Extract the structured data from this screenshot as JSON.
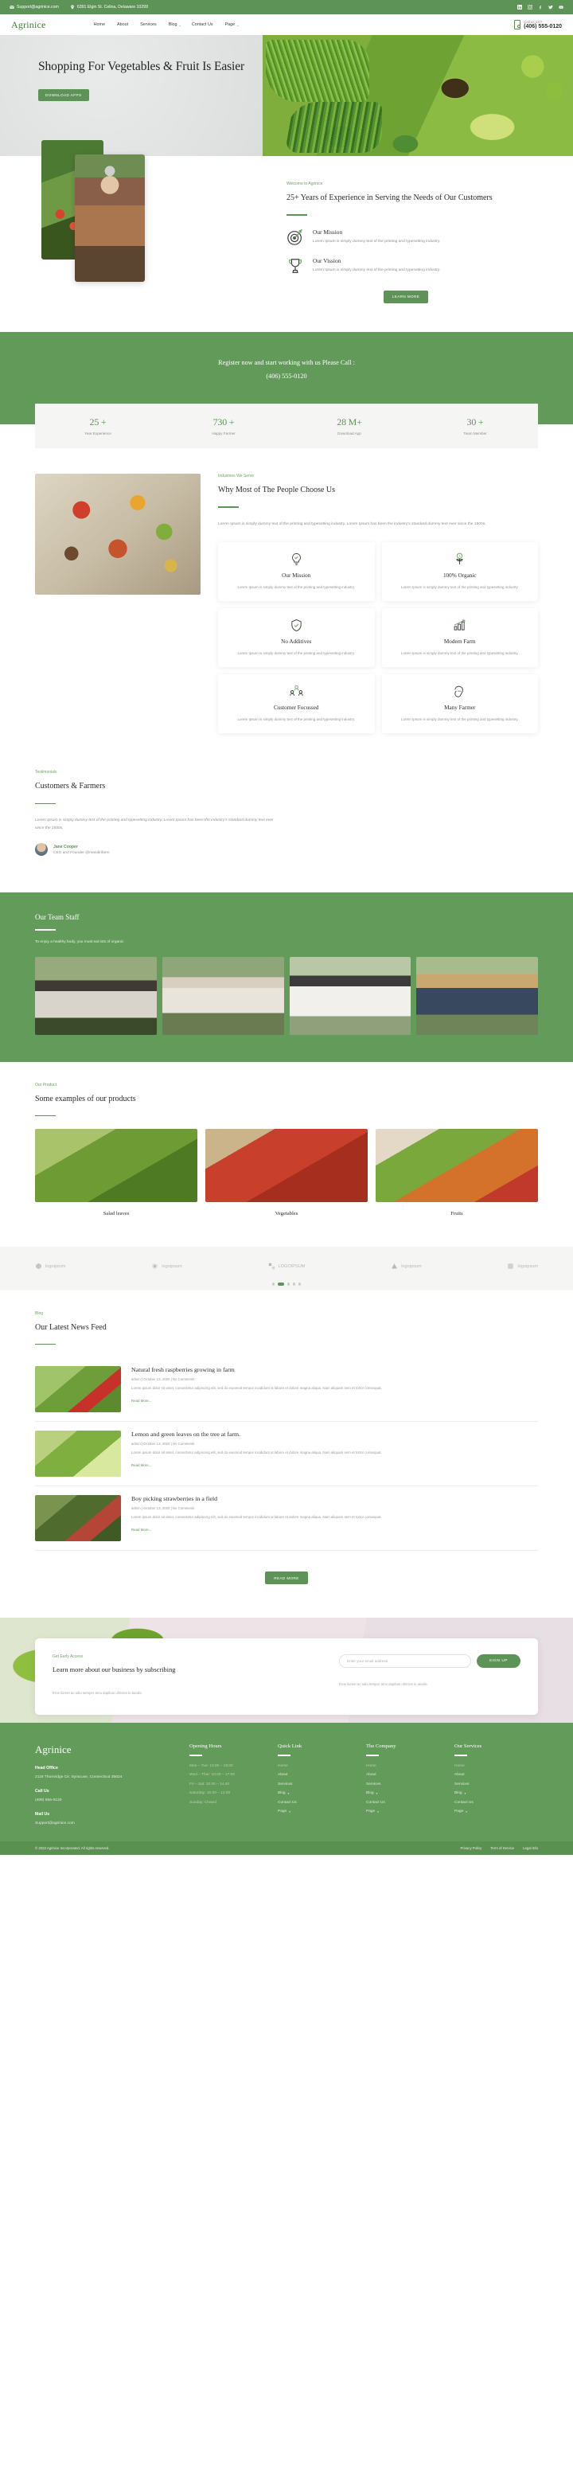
{
  "topbar": {
    "email": "Support@agrinice.com",
    "address": "6391 Elgin St. Celina, Delaware 10299",
    "socials": [
      "linkedin-icon",
      "instagram-icon",
      "facebook-icon",
      "twitter-icon",
      "youtube-icon"
    ]
  },
  "nav": {
    "brand": "Agrinice",
    "links": [
      {
        "label": "Home",
        "caret": ""
      },
      {
        "label": "About",
        "caret": ""
      },
      {
        "label": "Services",
        "caret": ""
      },
      {
        "label": "Blog",
        "caret": "⌄"
      },
      {
        "label": "Contact Us",
        "caret": ""
      },
      {
        "label": "Page",
        "caret": "⌄"
      }
    ],
    "call_label": "Call us 24/7",
    "call_number": "(406) 555-0120"
  },
  "hero": {
    "title": "Shopping For Vegetables & Fruit Is Easier",
    "button": "DOWNLOAD APPS"
  },
  "about": {
    "eyebrow": "Welcome to Agrinice",
    "title": "25+ Years of Experience in Serving the Needs of Our Customers",
    "features": [
      {
        "icon": "target-icon",
        "title": "Our Mission",
        "text": "Lorem Ipsum is simply dummy text of the printing and typesetting industry."
      },
      {
        "icon": "trophy-icon",
        "title": "Our Vission",
        "text": "Lorem Ipsum is simply dummy text of the printing and typesetting industry."
      }
    ],
    "button": "LEARN MORE"
  },
  "cta": {
    "line1": "Register now and start working with us Please Call :",
    "line2": "(406) 555-0120"
  },
  "stats": [
    {
      "number": "25 +",
      "label": "Year Experience"
    },
    {
      "number": "730 +",
      "label": "Happy Farmer"
    },
    {
      "number": "28 M+",
      "label": "Download App"
    },
    {
      "number": "30 +",
      "label": "Team Member"
    }
  ],
  "why": {
    "eyebrow": "Industries We Serve",
    "title": "Why Most of The People Choose Us",
    "paragraph": "Lorem Ipsum is simply dummy text of the printing and typesetting industry. Lorem Ipsum has been the industry's standard dummy text ever since the 1500s,",
    "cards": [
      {
        "icon": "lightbulb-icon",
        "title": "Our Mission",
        "text": "Lorem Ipsum is simply dummy text of the printing and typesetting industry."
      },
      {
        "icon": "organic-plant-icon",
        "title": "100% Organic",
        "text": "Lorem Ipsum is simply dummy text of the printing and typesetting industry."
      },
      {
        "icon": "shield-check-icon",
        "title": "No Additives",
        "text": "Lorem Ipsum is simply dummy text of the printing and typesetting industry."
      },
      {
        "icon": "growth-chart-icon",
        "title": "Modern Farm",
        "text": "Lorem Ipsum is simply dummy text of the printing and typesetting industry."
      },
      {
        "icon": "people-group-icon",
        "title": "Customer Focussed",
        "text": "Lorem Ipsum is simply dummy text of the printing and typesetting industry."
      },
      {
        "icon": "strong-arm-icon",
        "title": "Many Farmer",
        "text": "Lorem Ipsum is simply dummy text of the printing and typesetting industry."
      }
    ]
  },
  "testimonials": {
    "eyebrow": "Testimonials",
    "title": "Customers & Farmers",
    "quote": "Lorem Ipsum is simply dummy text of the printing and typesetting industry. Lorem Ipsum has been the industry's standard dummy text ever since the 1500s,",
    "author_name": "Jane Cooper",
    "author_role": "CEO and Founder @mandirifarm"
  },
  "team": {
    "title": "Our Team Staff",
    "subtitle": "To enjoy a healthy body, you must eat lots of organic",
    "members": [
      "team-member-1",
      "team-member-2",
      "team-member-3",
      "team-member-4"
    ]
  },
  "products": {
    "eyebrow": "Our Product",
    "title": "Some examples of our products",
    "items": [
      {
        "name": "Salad leaves"
      },
      {
        "name": "Vegetables"
      },
      {
        "name": "Fruits"
      }
    ]
  },
  "logos": [
    {
      "label": "logoipsum"
    },
    {
      "label": "logoipsum"
    },
    {
      "label": "LOGOIPSUM"
    },
    {
      "label": "logoipsum"
    },
    {
      "label": "logoipsum"
    }
  ],
  "carousel_dots": 5,
  "carousel_active": 1,
  "blog": {
    "eyebrow": "Blog",
    "title": "Our Latest News Feed",
    "posts": [
      {
        "title": "Natural fresh raspberries growing in farm",
        "meta": "admin | October 13, 2020 | No Comments",
        "text": "Lorem ipsum dolor sit amet, consectetur adipiscing elit, sed do eiusmod tempor incididunt ut labore et dolore magna aliqua. Nam aliquam sem et tortor consequat.",
        "link": "Read More..."
      },
      {
        "title": "Lemon and green leaves on the tree at farm.",
        "meta": "admin | October 13, 2020 | No Comments",
        "text": "Lorem ipsum dolor sit amet, consectetur adipiscing elit, sed do eiusmod tempor incididunt ut labore et dolore magna aliqua. Nam aliquam sem et tortor consequat.",
        "link": "Read More..."
      },
      {
        "title": "Boy picking strawberries in a field",
        "meta": "admin | October 13, 2020 | No Comments",
        "text": "Lorem ipsum dolor sit amet, consectetur adipiscing elit, sed do eiusmod tempor incididunt ut labore et dolore magna aliqua. Nam aliquam sem et tortor consequat.",
        "link": "Read More..."
      }
    ],
    "more_button": "READ MORE"
  },
  "newsletter": {
    "eyebrow": "Get Early Access",
    "title": "Learn more about our business by subscribing",
    "note_left": "Eros lioreet ac odio semper arcu dapibus ultricies in iaculis.",
    "note_right": "Eros lioreet ac odio tempor arcu dapibus ultricies in iaculis.",
    "placeholder": "Enter your email address",
    "button": "SIGN UP"
  },
  "footer": {
    "brand": "Agrinice",
    "head_office_label": "Head Office",
    "head_office_value": "2118 Thornridge Cir. Syracuse, Connecticut 35624",
    "call_label": "Call Us",
    "call_value": "(406) 555-0120",
    "mail_label": "Mail Us",
    "mail_value": "Support@agrinice.com",
    "columns": [
      {
        "title": "Opening Hours",
        "items": [
          {
            "label": "Mon – Tue: 10.00 – 18.00",
            "caret": ""
          },
          {
            "label": "Wed – Thur: 10.00 – 17.00",
            "caret": ""
          },
          {
            "label": "Fri – Sat: 10.00 – 14.00",
            "caret": ""
          },
          {
            "label": "Saturday: 10.00 – 12.00",
            "caret": ""
          },
          {
            "label": "Sunday: Closed",
            "caret": ""
          }
        ]
      },
      {
        "title": "Quick Link",
        "items": [
          {
            "label": "Home",
            "caret": ""
          },
          {
            "label": "About",
            "caret": ""
          },
          {
            "label": "Services",
            "caret": ""
          },
          {
            "label": "Blog",
            "caret": "▾"
          },
          {
            "label": "Contact Us",
            "caret": ""
          },
          {
            "label": "Page",
            "caret": "▾"
          }
        ]
      },
      {
        "title": "The Company",
        "items": [
          {
            "label": "Home",
            "caret": ""
          },
          {
            "label": "About",
            "caret": ""
          },
          {
            "label": "Services",
            "caret": ""
          },
          {
            "label": "Blog",
            "caret": "▾"
          },
          {
            "label": "Contact Us",
            "caret": ""
          },
          {
            "label": "Page",
            "caret": "▾"
          }
        ]
      },
      {
        "title": "Our Services",
        "items": [
          {
            "label": "Home",
            "caret": ""
          },
          {
            "label": "About",
            "caret": ""
          },
          {
            "label": "Services",
            "caret": ""
          },
          {
            "label": "Blog",
            "caret": "▾"
          },
          {
            "label": "Contact Us",
            "caret": ""
          },
          {
            "label": "Page",
            "caret": "▾"
          }
        ]
      }
    ],
    "copyright": "© 2022 Agrinice Incorporated. All rights reserved.",
    "bottom_links": [
      "Privacy Policy",
      "Term of Service",
      "Legal Info"
    ]
  },
  "colors": {
    "brand_green": "#5d9356",
    "band_green": "#639b5b",
    "light_grey": "#f5f5f3"
  }
}
